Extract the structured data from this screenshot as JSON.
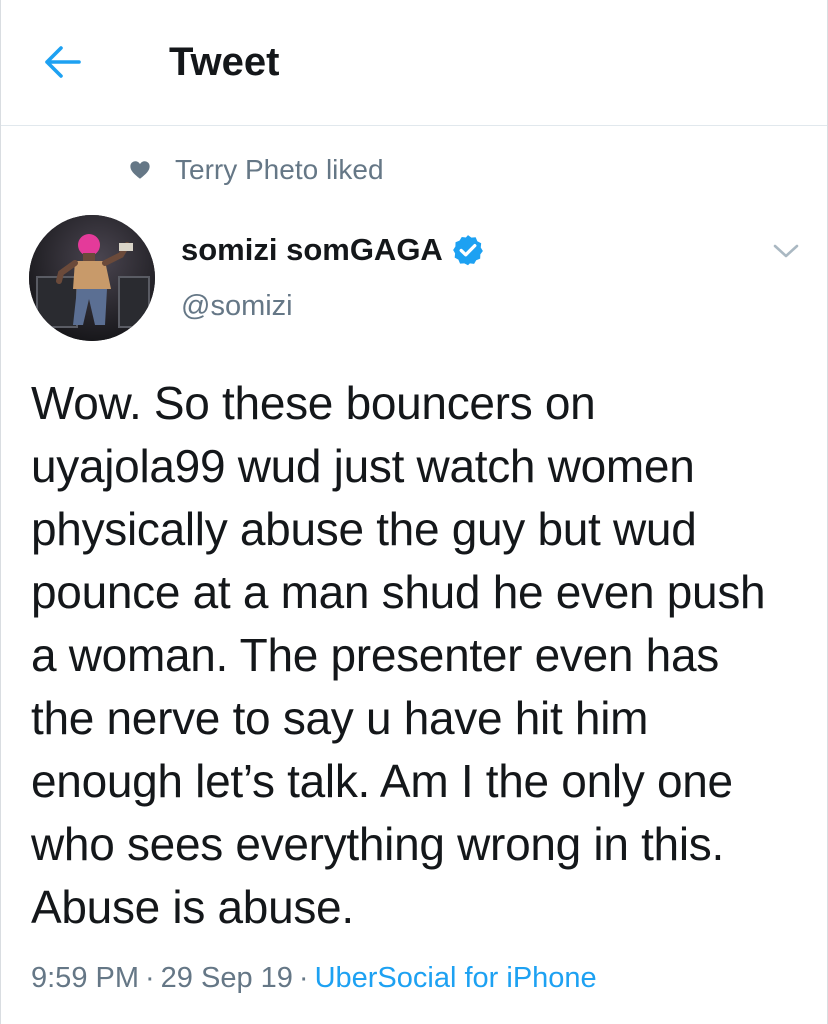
{
  "header": {
    "title": "Tweet",
    "back_icon": "arrow-left-icon",
    "accent_color": "#1da1f2"
  },
  "social_context": {
    "icon": "heart-icon",
    "text": "Terry Pheto liked"
  },
  "tweet": {
    "author": {
      "name": "somizi somGAGA",
      "handle": "@somizi",
      "verified": true
    },
    "text": "Wow. So these bouncers on uyajola99 wud just watch women physically abuse the guy but wud pounce at a man shud he even push a woman. The presenter even has the nerve to say u have hit him enough let’s talk. Am I the only one who sees everything wrong in this. Abuse is abuse.",
    "time": "9:59 PM",
    "date": "29 Sep 19",
    "separator": "·",
    "source": "UberSocial for iPhone"
  },
  "colors": {
    "text_primary": "#14171a",
    "text_secondary": "#657786",
    "link": "#1da1f2",
    "divider": "#e1e8ed"
  }
}
